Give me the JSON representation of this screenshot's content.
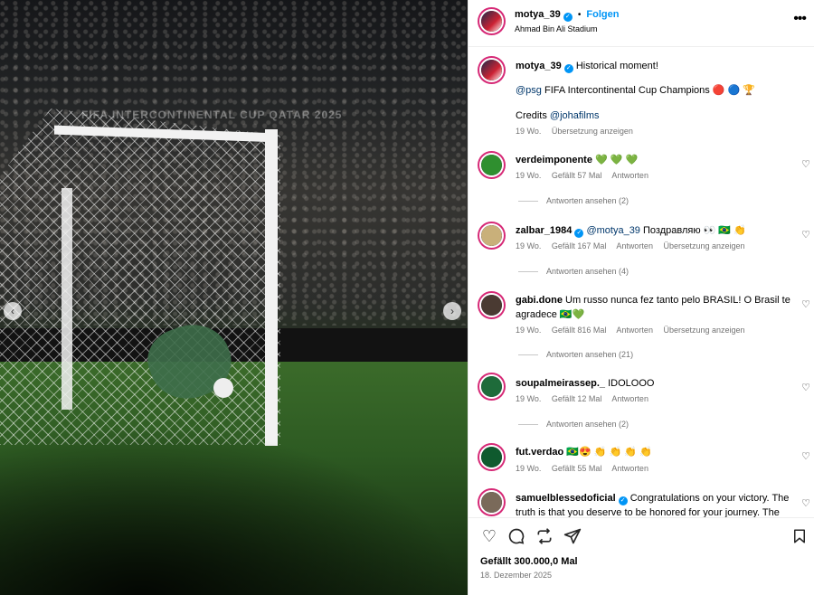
{
  "photo": {
    "ad_text": "FIFA INTERCONTINENTAL CUP QATAR 2025",
    "prev_icon": "chevron-left-icon",
    "next_icon": "chevron-right-icon"
  },
  "post_header": {
    "username": "motya_39",
    "dot": "•",
    "follow_label": "Folgen",
    "location": "Ahmad Bin Ali Stadium",
    "more_icon": "more-horizontal-icon"
  },
  "caption": {
    "username": "motya_39",
    "text": "Historical moment!",
    "mention": "@psg",
    "line2": "FIFA Intercontinental Cup Champions 🔴 🔵 🏆",
    "credits_label": "Credits",
    "credits_mention": "@johafilms",
    "time": "19 Wo.",
    "translate": "Übersetzung anzeigen"
  },
  "comments": [
    {
      "username": "verdeimponente",
      "text": "💚 💚 💚",
      "time": "19 Wo.",
      "likes": "Gefällt 57 Mal",
      "reply": "Antworten",
      "view_replies": "Antworten ansehen (2)",
      "avatar_color": "#2f8f2f"
    },
    {
      "username": "zalbar_1984",
      "mention": "@motya_39",
      "text": "Поздравляю 👀 🇧🇷 👏",
      "time": "19 Wo.",
      "likes": "Gefällt 167 Mal",
      "reply": "Antworten",
      "translate": "Übersetzung anzeigen",
      "view_replies": "Antworten ansehen (4)",
      "avatar_color": "#c9b07a"
    },
    {
      "username": "gabi.done",
      "text": "Um russo nunca fez tanto pelo BRASIL! O Brasil te agradece 🇧🇷💚",
      "time": "19 Wo.",
      "likes": "Gefällt 816 Mal",
      "reply": "Antworten",
      "translate": "Übersetzung anzeigen",
      "view_replies": "Antworten ansehen (21)",
      "avatar_color": "#4a3a32"
    },
    {
      "username": "soupalmeirassep._",
      "text": "IDOLOOO",
      "time": "19 Wo.",
      "likes": "Gefällt 12 Mal",
      "reply": "Antworten",
      "view_replies": "Antworten ansehen (2)",
      "avatar_color": "#1e6b3a"
    },
    {
      "username": "fut.verdao",
      "text": "🇧🇷😍 👏 👏 👏 👏",
      "time": "19 Wo.",
      "likes": "Gefällt 55 Mal",
      "reply": "Antworten",
      "avatar_color": "#0f5a2e"
    },
    {
      "username": "samuelblessedoficial",
      "text": "Congratulations on your victory. The truth is that you deserve to be honored for your journey. The",
      "avatar_color": "#7a6a5a"
    }
  ],
  "actions": {
    "like_icon": "heart-icon",
    "comment_icon": "comment-icon",
    "repost_icon": "repost-icon",
    "share_icon": "send-icon",
    "save_icon": "bookmark-icon",
    "likes_label": "Gefällt 300.000,0 Mal",
    "date": "18. Dezember 2025"
  },
  "colors": {
    "accent": "#0095f6",
    "link": "#00376b",
    "muted": "#737373",
    "story_ring": "#d62976"
  }
}
